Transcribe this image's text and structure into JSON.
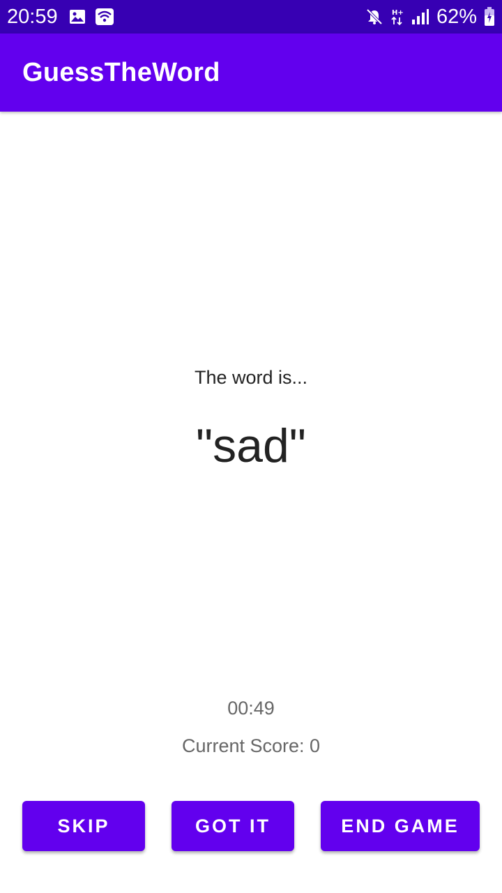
{
  "status_bar": {
    "time": "20:59",
    "battery_percent": "62%",
    "network_type": "H+",
    "icons": [
      "image-icon",
      "wifi-icon",
      "mute-icon",
      "network-activity-icon",
      "signal-icon",
      "battery-icon"
    ]
  },
  "app_bar": {
    "title": "GuessTheWord"
  },
  "game": {
    "word_label": "The word is...",
    "word": "\"sad\"",
    "timer": "00:49",
    "score": "Current Score: 0"
  },
  "buttons": {
    "skip": "SKIP",
    "got_it": "GOT IT",
    "end_game": "END GAME"
  },
  "colors": {
    "status_bar": "#3700b3",
    "primary": "#6200ee",
    "text_primary": "#222222",
    "text_secondary": "#666666"
  }
}
